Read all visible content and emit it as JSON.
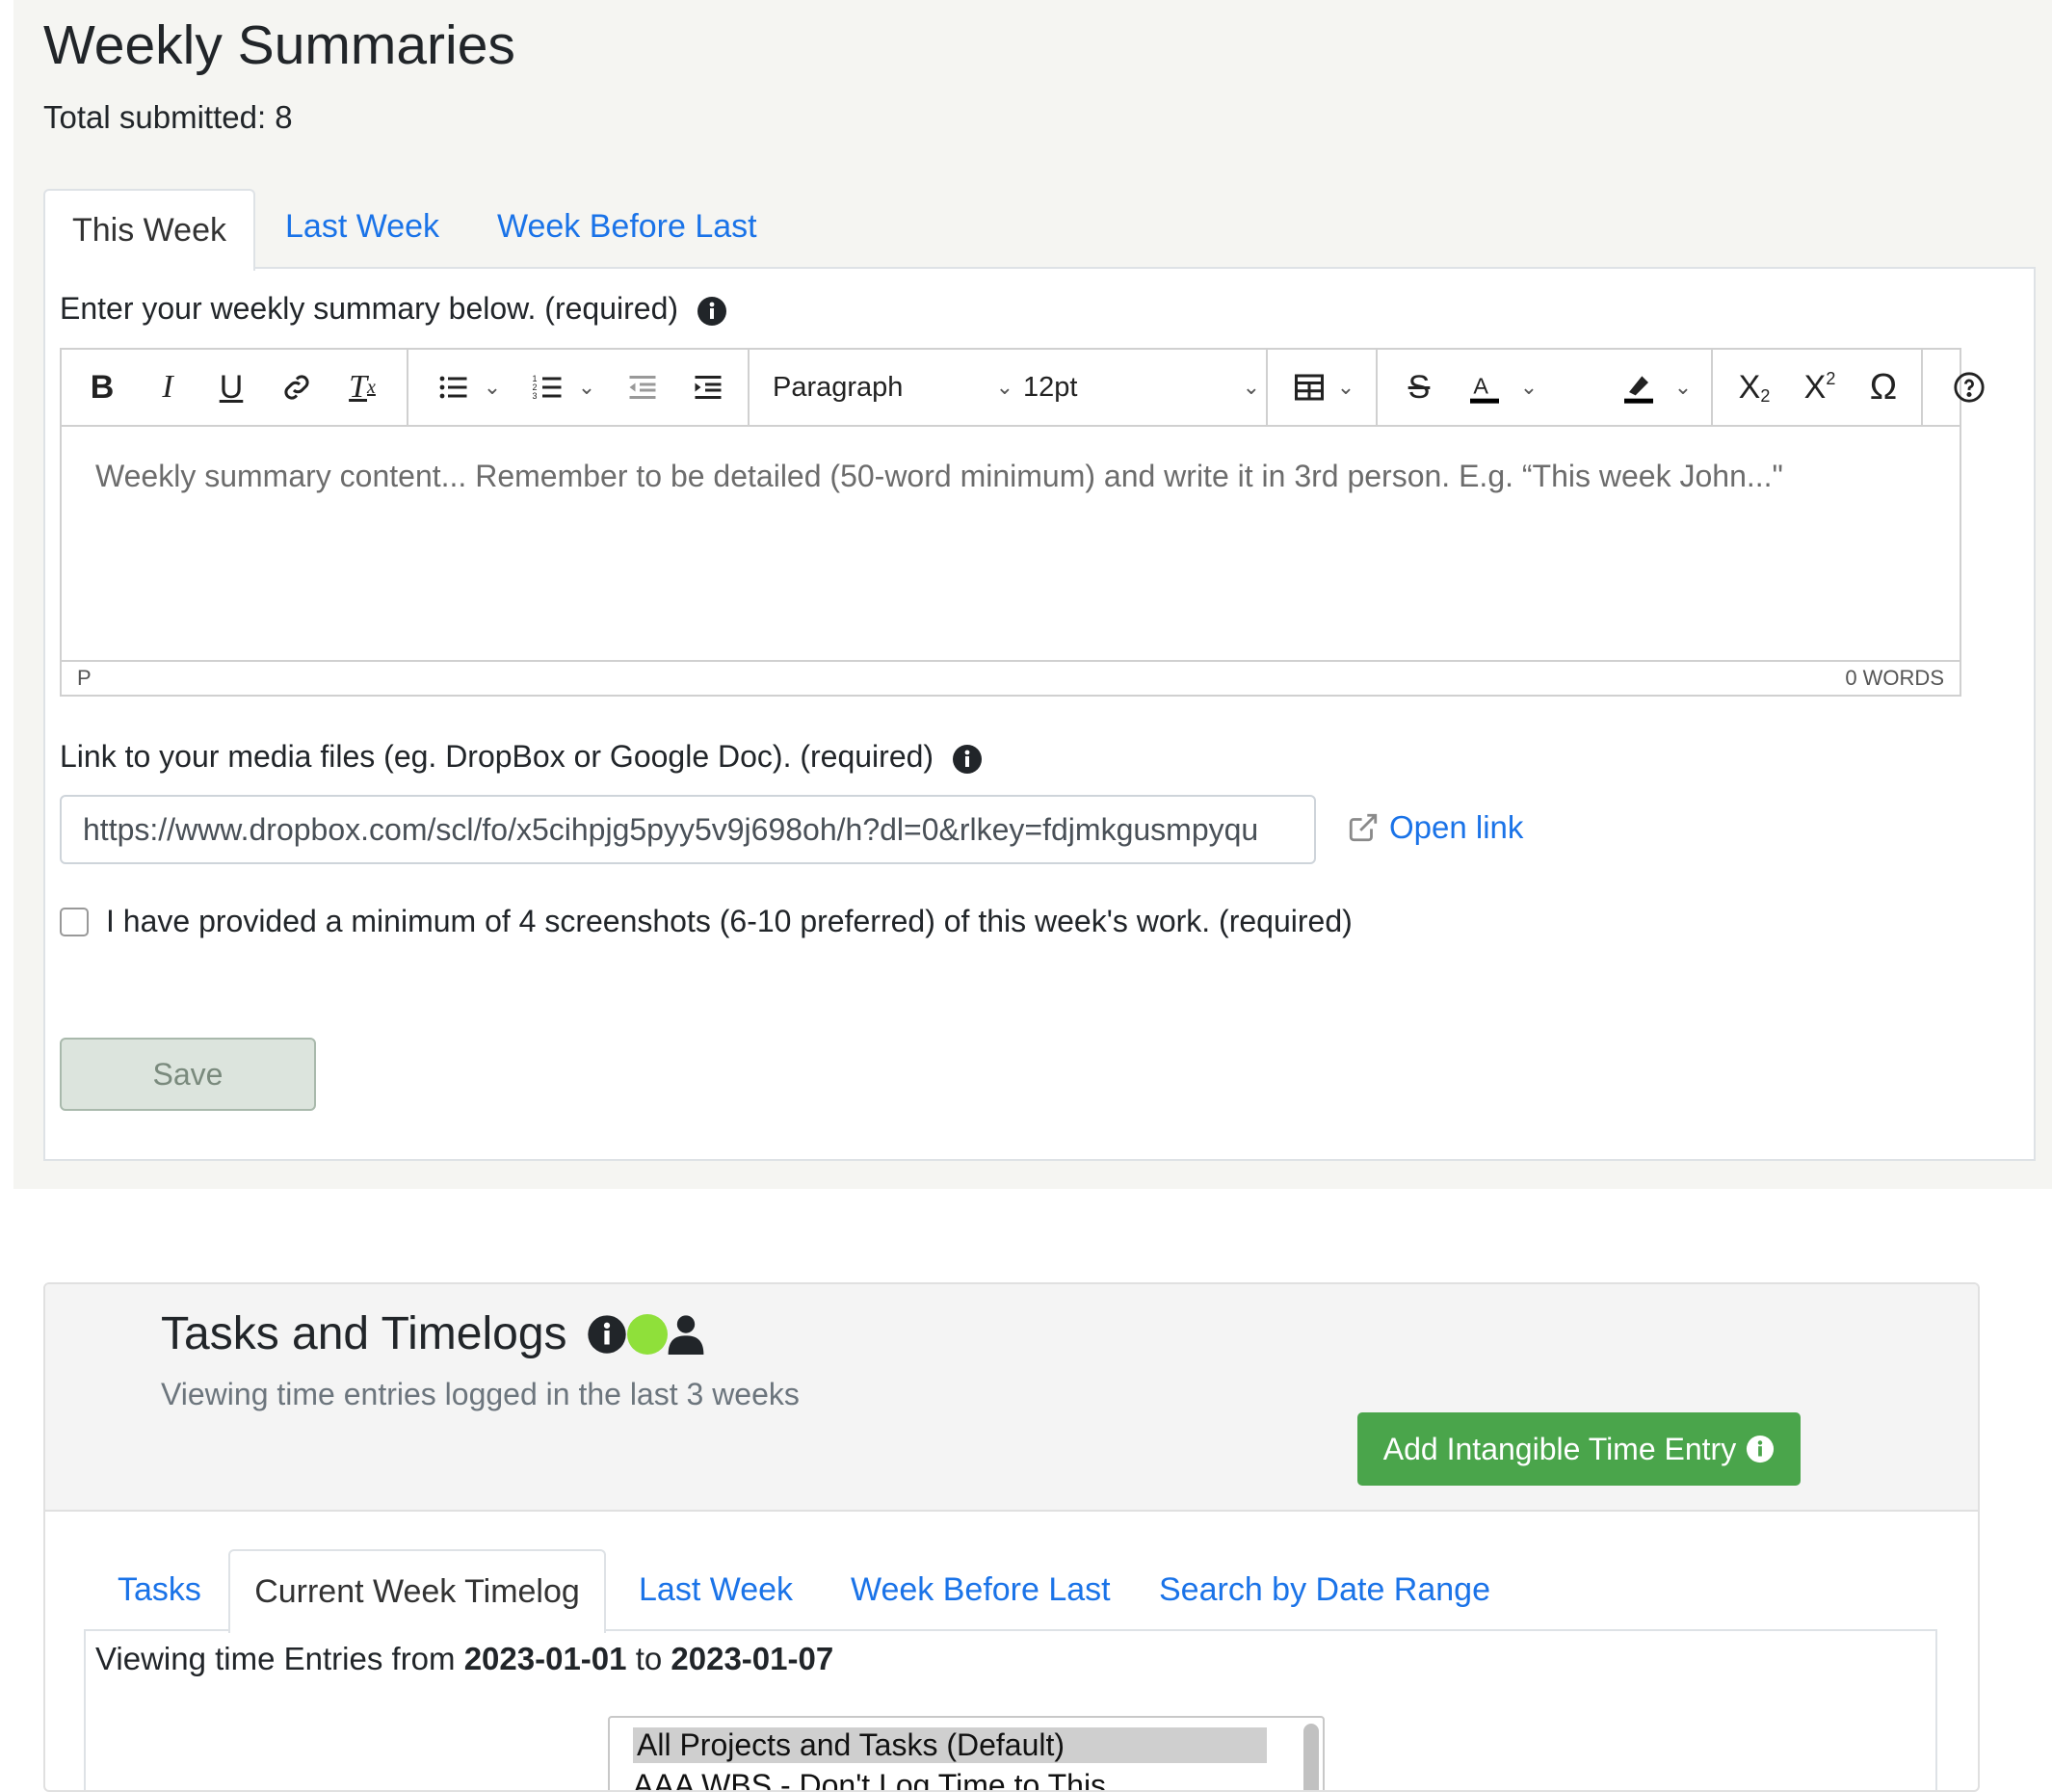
{
  "weekly": {
    "title": "Weekly Summaries",
    "total": "Total submitted: 8",
    "tabs": [
      "This Week",
      "Last Week",
      "Week Before Last"
    ],
    "summary_label": "Enter your weekly summary below. (required)",
    "editor": {
      "format_select": "Paragraph",
      "size_select": "12pt",
      "placeholder": "Weekly summary content... Remember to be detailed (50-word minimum) and write it in 3rd person. E.g. “This week John...\"",
      "status_path": "P",
      "word_count": "0 WORDS"
    },
    "media_label": "Link to your media files (eg. DropBox or Google Doc). (required)",
    "media_value": "https://www.dropbox.com/scl/fo/x5cihpjg5pyy5v9j698oh/h?dl=0&rlkey=fdjmkgusmpyqu",
    "open_link": "Open link",
    "checkbox_label": "I have provided a minimum of 4 screenshots (6-10 preferred) of this week's work. (required)",
    "save": "Save"
  },
  "timelogs": {
    "title": "Tasks and Timelogs",
    "subtitle": "Viewing time entries logged in the last 3 weeks",
    "add_button": "Add Intangible Time Entry",
    "tabs": [
      "Tasks",
      "Current Week Timelog",
      "Last Week",
      "Week Before Last",
      "Search by Date Range"
    ],
    "range_prefix": "Viewing time Entries from",
    "range_start": "2023-01-01",
    "range_mid": "to",
    "range_end": "2023-01-07",
    "filter_options": [
      "All Projects and Tasks (Default)",
      "AAA WBS - Don't Log Time to This"
    ],
    "status_color": "#8fe03a"
  }
}
